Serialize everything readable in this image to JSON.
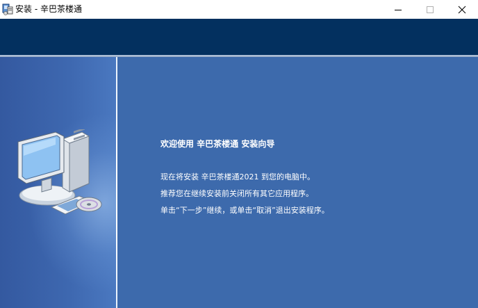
{
  "window": {
    "title": "安装 - 辛巴茶楼通",
    "app_icon": "installer-icon",
    "controls": {
      "minimize_icon": "minimize-icon",
      "maximize_icon": "maximize-icon",
      "close_icon": "close-icon"
    }
  },
  "welcome": {
    "title": "欢迎使用 辛巴茶楼通 安装向导",
    "lines": [
      "现在将安装 辛巴茶楼通2021 到您的电脑中。",
      "推荐您在继续安装前关闭所有其它应用程序。",
      "单击“下一步”继续，或单击“取消”退出安装程序。"
    ]
  },
  "side_image": "computer-cd-illustration",
  "colors": {
    "header": "#03305f",
    "panel": "#3d6aac",
    "side_panel": "#3459a0",
    "text": "#ffffff"
  }
}
